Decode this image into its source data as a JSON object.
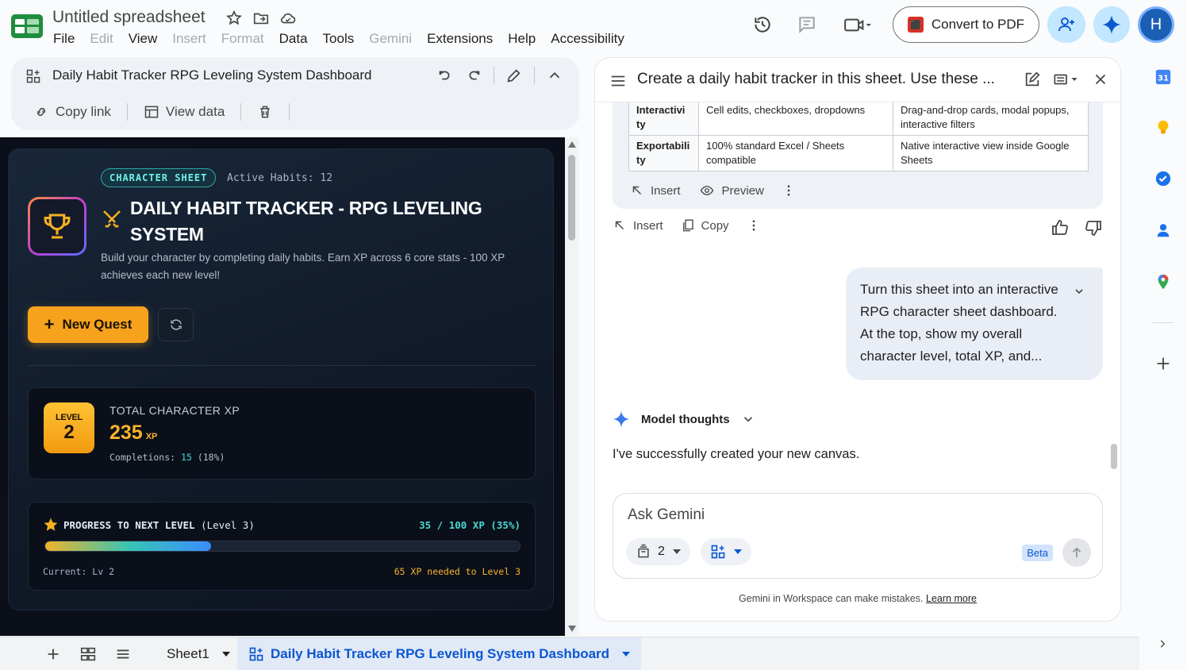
{
  "app": {
    "doc_title": "Untitled spreadsheet",
    "menu": [
      {
        "label": "File",
        "enabled": true
      },
      {
        "label": "Edit",
        "enabled": false
      },
      {
        "label": "View",
        "enabled": true
      },
      {
        "label": "Insert",
        "enabled": false
      },
      {
        "label": "Format",
        "enabled": false
      },
      {
        "label": "Data",
        "enabled": true
      },
      {
        "label": "Tools",
        "enabled": true
      },
      {
        "label": "Gemini",
        "enabled": false
      },
      {
        "label": "Extensions",
        "enabled": true
      },
      {
        "label": "Help",
        "enabled": true
      },
      {
        "label": "Accessibility",
        "enabled": true
      }
    ],
    "convert_label": "Convert to PDF",
    "avatar_initial": "H",
    "accent": "#0b57d0"
  },
  "panel": {
    "title": "Daily Habit Tracker RPG Leveling System Dashboard",
    "copy_link": "Copy link",
    "view_data": "View data"
  },
  "dashboard": {
    "tag": "CHARACTER SHEET",
    "active_habits": "Active Habits: 12",
    "title": "DAILY HABIT TRACKER - RPG LEVELING SYSTEM",
    "description": "Build your character by completing daily habits. Earn XP across 6 core stats - 100 XP achieves each new level!",
    "new_quest": "New Quest",
    "level_label": "LEVEL",
    "level": "2",
    "xp_label": "TOTAL CHARACTER XP",
    "xp_value": "235",
    "xp_unit": "XP",
    "completions_label": "Completions:",
    "completions_value": "15",
    "completions_pct": "(18%)",
    "progress_title": "PROGRESS TO NEXT LEVEL",
    "progress_level": "(Level 3)",
    "progress_right": "35 / 100 XP (35%)",
    "progress_fraction": 0.35,
    "current_level": "Current: Lv 2",
    "needed": "65 XP needed to Level 3"
  },
  "sheets": {
    "tab1": "Sheet1",
    "tab2": "Daily Habit Tracker RPG Leveling System Dashboard"
  },
  "gemini": {
    "header_title": "Create a daily habit tracker in this sheet. Use these ...",
    "table": [
      {
        "key": "Interactivi ty",
        "a": "Cell edits, checkboxes, dropdowns",
        "b": "Drag-and-drop cards, modal popups, interactive filters"
      },
      {
        "key": "Exportabili ty",
        "a": "100% standard Excel / Sheets compatible",
        "b": "Native interactive view inside Google Sheets"
      }
    ],
    "insert": "Insert",
    "preview": "Preview",
    "copy": "Copy",
    "user_message": "Turn this sheet into an interactive RPG character sheet dashboard. At the top, show my overall character level, total XP, and...",
    "model_thoughts": "Model thoughts",
    "reply": "I've successfully created your new canvas.",
    "ask_placeholder": "Ask Gemini",
    "source_count": "2",
    "beta": "Beta",
    "disclaimer": "Gemini in Workspace can make mistakes.",
    "learn_more": "Learn more"
  }
}
